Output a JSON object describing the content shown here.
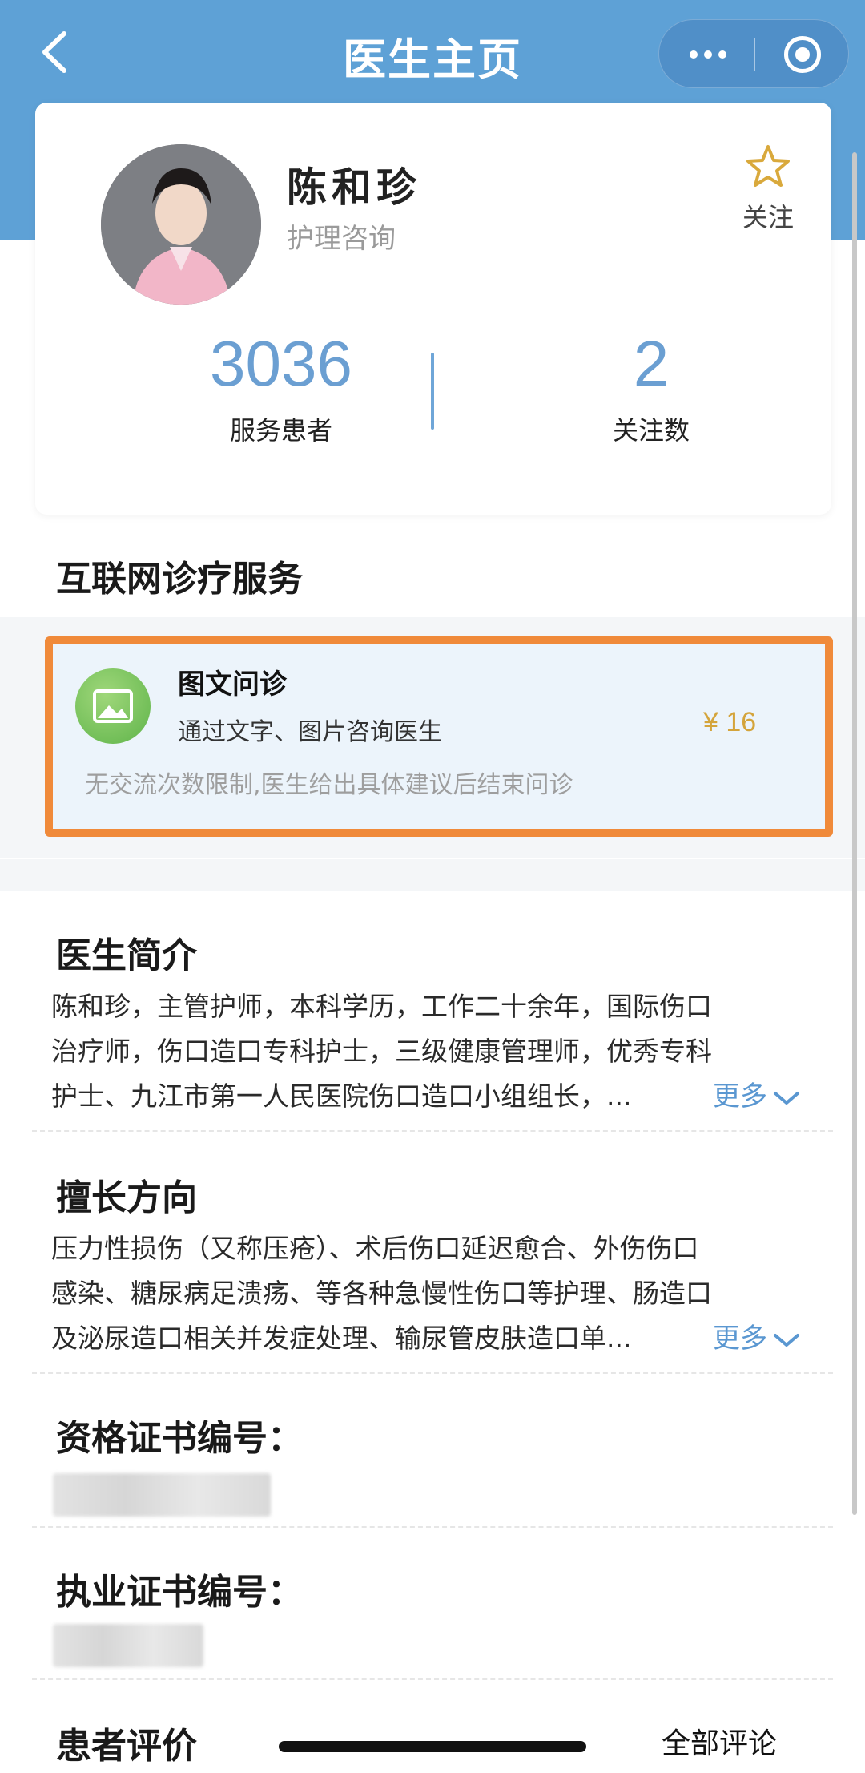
{
  "nav": {
    "title": "医生主页"
  },
  "doctor": {
    "name": "陈和珍",
    "department": "护理咨询",
    "follow_label": "关注"
  },
  "stats": [
    {
      "value": "3036",
      "label": "服务患者"
    },
    {
      "value": "2",
      "label": "关注数"
    }
  ],
  "service_section": {
    "title": "互联网诊疗服务",
    "item": {
      "title": "图文问诊",
      "subtitle": "通过文字、图片咨询医生",
      "price": "¥ 16",
      "note": "无交流次数限制,医生给出具体建议后结束问诊"
    }
  },
  "intro": {
    "title": "医生简介",
    "lines": [
      "陈和珍，主管护师，本科学历，工作二十余年，国际伤口",
      "治疗师，伤口造口专科护士，三级健康管理师，优秀专科",
      "护士、九江市第一人民医院伤口造口小组组长，..."
    ],
    "more": "更多"
  },
  "specialty": {
    "title": "擅长方向",
    "lines": [
      "压力性损伤（又称压疮）、术后伤口延迟愈合、外伤伤口",
      "感染、糖尿病足溃疡、等各种急慢性伤口等护理、肠造口",
      "及泌尿造口相关并发症处理、输尿管皮肤造口单..."
    ],
    "more": "更多"
  },
  "qualification": {
    "title": "资格证书编号："
  },
  "license": {
    "title": "执业证书编号："
  },
  "reviews": {
    "title": "患者评价",
    "all_label": "全部评论"
  },
  "colors": {
    "header": "#5ea1d6",
    "accent": "#6b9fd2",
    "price": "#d4a43b",
    "highlight_border": "#f08a3a"
  }
}
